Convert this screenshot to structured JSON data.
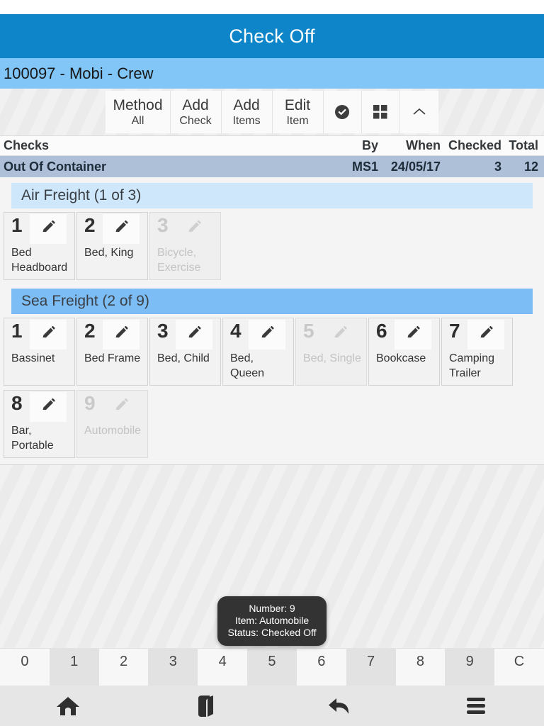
{
  "window": {
    "title": "Check Off",
    "subtitle": "100097 - Mobi - Crew"
  },
  "colors": {
    "titlebar": "#0d85c8",
    "subtitlebar": "#81c6f7",
    "check_row": "#adc0d8",
    "group_air": "#cfe7fb",
    "group_sea": "#7cbdf5",
    "tooltip_bg": "#333333"
  },
  "toolbar": {
    "buttons": [
      {
        "line1": "Method",
        "line2": "All",
        "icon": null
      },
      {
        "line1": "Add",
        "line2": "Check",
        "icon": null
      },
      {
        "line1": "Add",
        "line2": "Items",
        "icon": null
      },
      {
        "line1": "Edit",
        "line2": "Item",
        "icon": null
      }
    ],
    "icon_buttons": [
      {
        "icon": "check-circle-icon"
      },
      {
        "icon": "grid-icon"
      },
      {
        "icon": "chevron-up-icon"
      }
    ]
  },
  "checks_table": {
    "headers": {
      "name": "Checks",
      "by": "By",
      "when": "When",
      "checked": "Checked",
      "total": "Total"
    },
    "rows": [
      {
        "name": "Out Of Container",
        "by": "MS1",
        "when": "24/05/17",
        "checked": "3",
        "total": "12"
      }
    ]
  },
  "groups": [
    {
      "title": "Air Freight (1 of 3)",
      "style": "air",
      "items": [
        {
          "number": "1",
          "label": "Bed Headboard",
          "disabled": false
        },
        {
          "number": "2",
          "label": "Bed, King",
          "disabled": false
        },
        {
          "number": "3",
          "label": "Bicycle, Exercise",
          "disabled": true
        }
      ]
    },
    {
      "title": "Sea Freight (2 of 9)",
      "style": "sea",
      "items": [
        {
          "number": "1",
          "label": "Bassinet",
          "disabled": false
        },
        {
          "number": "2",
          "label": "Bed Frame",
          "disabled": false
        },
        {
          "number": "3",
          "label": "Bed, Child",
          "disabled": false
        },
        {
          "number": "4",
          "label": "Bed, Queen",
          "disabled": false
        },
        {
          "number": "5",
          "label": "Bed, Single",
          "disabled": true
        },
        {
          "number": "6",
          "label": "Bookcase",
          "disabled": false
        },
        {
          "number": "7",
          "label": "Camping Trailer",
          "disabled": false
        },
        {
          "number": "8",
          "label": "Bar, Portable",
          "disabled": false
        },
        {
          "number": "9",
          "label": "Automobile",
          "disabled": true
        }
      ]
    }
  ],
  "tooltip": {
    "line1": "Number: 9",
    "line2": "Item: Automobile",
    "line3": "Status: Checked Off"
  },
  "numpad": {
    "keys": [
      "0",
      "1",
      "2",
      "3",
      "4",
      "5",
      "6",
      "7",
      "8",
      "9",
      "C"
    ]
  },
  "bottom_nav": {
    "items": [
      {
        "icon": "home-icon"
      },
      {
        "icon": "book-icon"
      },
      {
        "icon": "back-arrow-icon"
      },
      {
        "icon": "hamburger-menu-icon"
      }
    ]
  }
}
